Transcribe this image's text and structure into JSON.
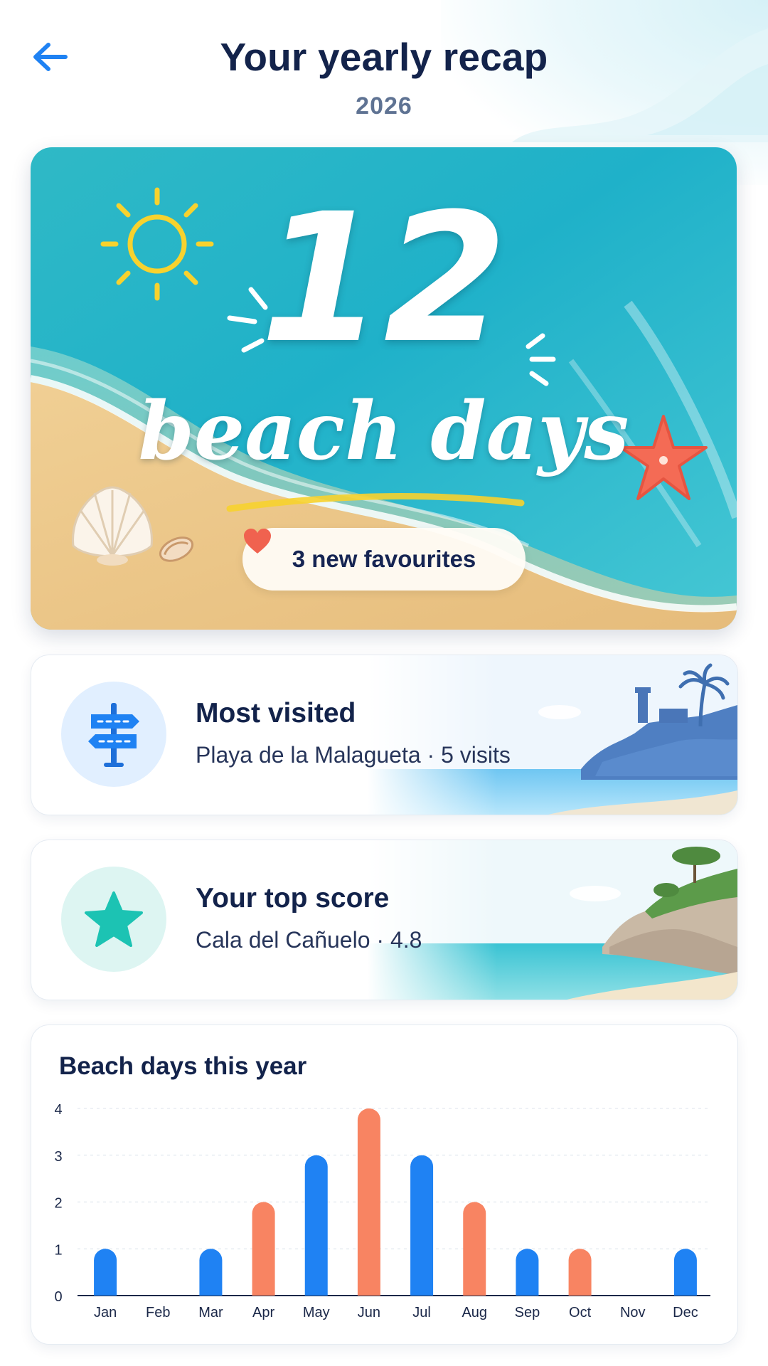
{
  "header": {
    "title": "Your yearly recap",
    "year": "2026",
    "back_icon": "arrow-left-icon"
  },
  "hero": {
    "count": "12",
    "label": "beach days",
    "favourites_text": "3 new favourites",
    "favourites_icon": "heart-icon"
  },
  "most_visited": {
    "title": "Most visited",
    "subtitle": "Playa de la Malagueta · 5 visits",
    "icon": "signpost-icon"
  },
  "top_score": {
    "title": "Your top score",
    "subtitle": "Cala del Cañuelo · 4.8",
    "icon": "star-icon"
  },
  "colors": {
    "blue": "#1f82f3",
    "coral": "#f88462",
    "navy": "#13234b",
    "teal": "#1cc3b3"
  },
  "chart_data": {
    "type": "bar",
    "title": "Beach days this year",
    "categories": [
      "Jan",
      "Feb",
      "Mar",
      "Apr",
      "May",
      "Jun",
      "Jul",
      "Aug",
      "Sep",
      "Oct",
      "Nov",
      "Dec"
    ],
    "values": [
      1,
      0,
      1,
      2,
      3,
      4,
      3,
      2,
      1,
      1,
      0,
      1
    ],
    "bar_colors": [
      "blue",
      "blue",
      "blue",
      "coral",
      "blue",
      "coral",
      "blue",
      "coral",
      "blue",
      "coral",
      "blue",
      "blue"
    ],
    "yticks": [
      0,
      1,
      2,
      3,
      4
    ],
    "ylim": [
      0,
      4
    ],
    "grid": true
  }
}
